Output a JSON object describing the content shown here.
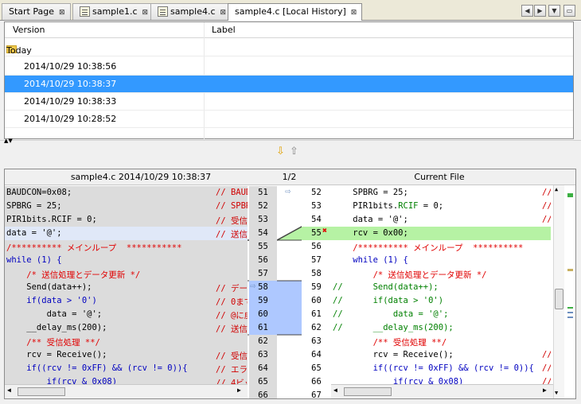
{
  "tabs": [
    {
      "label": "Start Page",
      "icon": false
    },
    {
      "label": "sample1.c",
      "icon": true
    },
    {
      "label": "sample4.c",
      "icon": true
    },
    {
      "label": "sample4.c [Local History]",
      "icon": false,
      "active": true
    }
  ],
  "close_glyph": "⊠",
  "history": {
    "col_version": "Version",
    "col_label": "Label",
    "group": "Today",
    "rows": [
      "2014/10/29 10:38:56",
      "2014/10/29 10:38:37",
      "2014/10/29 10:38:33",
      "2014/10/29 10:28:52"
    ],
    "selected_index": 1
  },
  "diff": {
    "left_title": "sample4.c 2014/10/29 10:38:37",
    "counter": "1/2",
    "right_title": "Current File",
    "lines": [
      {
        "l": "BAUDCON=0x08;",
        "lc": "// BAUD",
        "ln": "51",
        "rn": "52",
        "r": "    SPBRG = 25;",
        "rc": "//"
      },
      {
        "l": "SPBRG = 25;",
        "lc": "// SPBR",
        "ln": "52",
        "rn": "53",
        "r": "    PIR1bits.RCIF = 0;",
        "rc": "//"
      },
      {
        "l": "PIR1bits.RCIF = 0;",
        "lc": "// 受信",
        "ln": "53",
        "rn": "54",
        "r": "    data = '@';",
        "rc": "//"
      },
      {
        "l": "data = '@';",
        "lc": "// 送信",
        "ln": "54",
        "rn": "55",
        "r": "    rcv = 0x00;",
        "rc": ""
      },
      {
        "l": "/********** メインループ  ***********",
        "lc": "",
        "ln": "55",
        "rn": "56",
        "r": "    /********** メインループ  **********",
        "rc": ""
      },
      {
        "l": "while (1) {",
        "lc": "",
        "ln": "56",
        "rn": "57",
        "r": "    while (1) {",
        "rc": ""
      },
      {
        "l": "    /* 送信処理とデータ更新 */",
        "lc": "",
        "ln": "57",
        "rn": "58",
        "r": "        /* 送信処理とデータ更新 */",
        "rc": ""
      },
      {
        "l": "    Send(data++);",
        "lc": "// デー",
        "ln": "58",
        "rn": "59",
        "r": "//      Send(data++);",
        "rc": ""
      },
      {
        "l": "    if(data > '0')",
        "lc": "// 0まで",
        "ln": "59",
        "rn": "60",
        "r": "//      if(data > '0')",
        "rc": ""
      },
      {
        "l": "        data = '@';",
        "lc": "// @に戻",
        "ln": "60",
        "rn": "61",
        "r": "//          data = '@';",
        "rc": ""
      },
      {
        "l": "    __delay_ms(200);",
        "lc": "// 送信",
        "ln": "61",
        "rn": "62",
        "r": "//      __delay_ms(200);",
        "rc": ""
      },
      {
        "l": "    /** 受信処理 **/",
        "lc": "",
        "ln": "62",
        "rn": "63",
        "r": "        /** 受信処理 **/",
        "rc": ""
      },
      {
        "l": "    rcv = Receive();",
        "lc": "// 受信",
        "ln": "63",
        "rn": "64",
        "r": "        rcv = Receive();",
        "rc": "//"
      },
      {
        "l": "    if((rcv != 0xFF) && (rcv != 0)){",
        "lc": "// エラ",
        "ln": "64",
        "rn": "65",
        "r": "        if((rcv != 0xFF) && (rcv != 0)){",
        "rc": "//"
      },
      {
        "l": "        if(rcv & 0x08)",
        "lc": "// 4ビッ",
        "ln": "65",
        "rn": "66",
        "r": "            if(rcv & 0x08)",
        "rc": "//"
      },
      {
        "l": "",
        "lc": "",
        "ln": "66",
        "rn": "67",
        "r": "",
        "rc": ""
      }
    ]
  },
  "colors": {
    "selection": "#3399ff",
    "added": "#b6f2a4",
    "changed": "#aec8ff"
  }
}
